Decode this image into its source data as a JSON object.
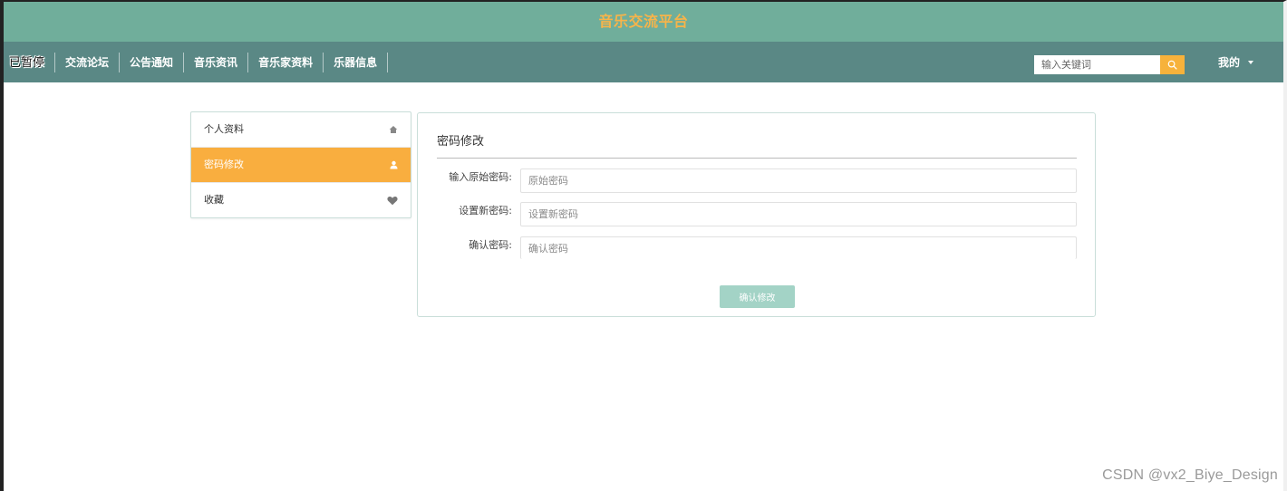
{
  "header": {
    "site_title": "音乐交流平台"
  },
  "nav": {
    "paused_badge": "已暂停",
    "items": [
      {
        "label": "首页"
      },
      {
        "label": "交流论坛"
      },
      {
        "label": "公告通知"
      },
      {
        "label": "音乐资讯"
      },
      {
        "label": "音乐家资料"
      },
      {
        "label": "乐器信息"
      }
    ],
    "search_placeholder": "输入关键词",
    "search_icon": "search-icon",
    "my_menu_label": "我的",
    "my_menu_icon": "caret-down-icon"
  },
  "sidebar": {
    "items": [
      {
        "label": "个人资料",
        "icon": "home-icon",
        "active": false
      },
      {
        "label": "密码修改",
        "icon": "user-icon",
        "active": true
      },
      {
        "label": "收藏",
        "icon": "heart-icon",
        "active": false
      }
    ]
  },
  "form": {
    "title": "密码修改",
    "fields": [
      {
        "label": "输入原始密码:",
        "placeholder": "原始密码"
      },
      {
        "label": "设置新密码:",
        "placeholder": "设置新密码"
      },
      {
        "label": "确认密码:",
        "placeholder": "确认密码"
      }
    ],
    "submit_label": "确认修改"
  },
  "watermark": {
    "text": "CSDN @vx2_Biye_Design"
  },
  "colors": {
    "brand_bar": "#70ae9b",
    "nav_bar": "#5a8885",
    "accent_orange": "#f9ae3f",
    "title_orange": "#f7b44a",
    "button_disabled": "#a3d3c6"
  }
}
